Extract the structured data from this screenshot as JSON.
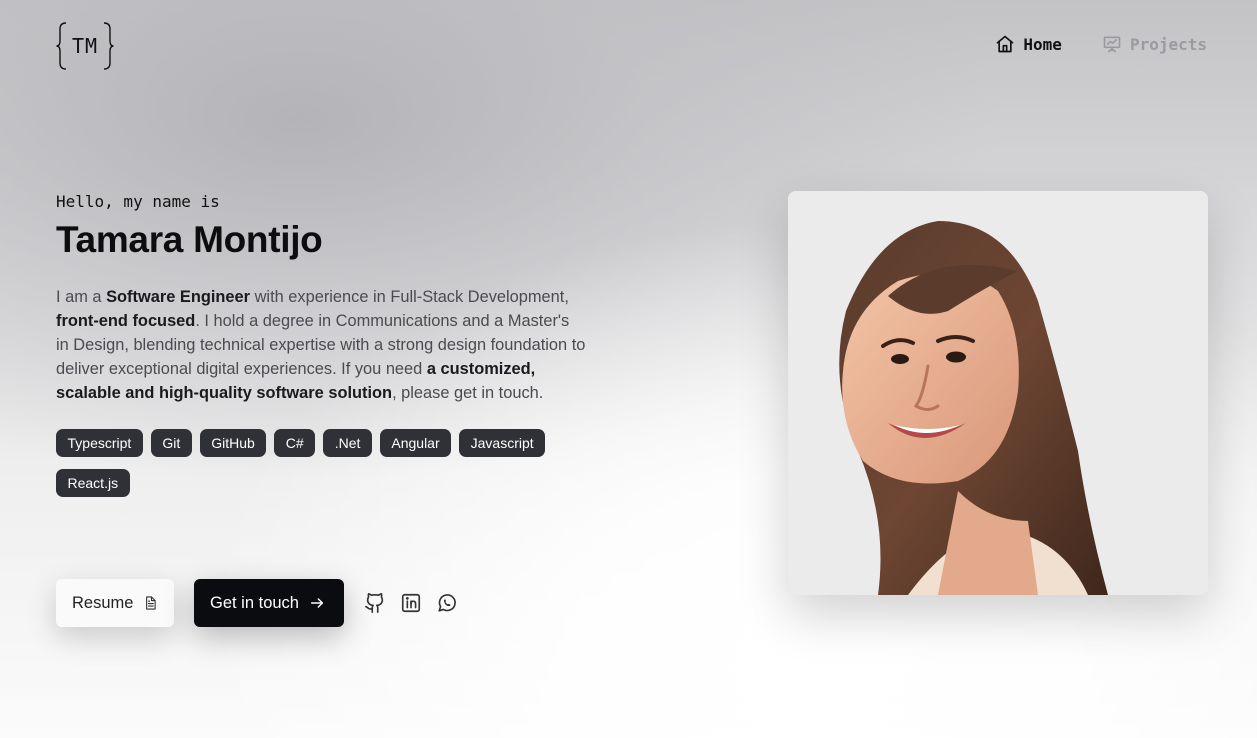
{
  "logo": {
    "text": "TM"
  },
  "nav": {
    "items": [
      {
        "label": "Home",
        "icon": "home-icon",
        "active": true
      },
      {
        "label": "Projects",
        "icon": "presentation-icon",
        "active": false
      }
    ]
  },
  "hero": {
    "greeting": "Hello, my name is",
    "name": "Tamara Montijo",
    "bio": {
      "p1": "I am a ",
      "b1": "Software Engineer",
      "p2": " with experience in Full-Stack Development, ",
      "b2": "front-end focused",
      "p3": ". I hold a degree in Communications and a Master's in Design, blending technical expertise with a strong design foundation to deliver exceptional digital experiences. If you need ",
      "b3": "a customized, scalable and high-quality software solution",
      "p4": ", please get in touch."
    },
    "tags": [
      "Typescript",
      "Git",
      "GitHub",
      "C#",
      ".Net",
      "Angular",
      "Javascript",
      "React.js"
    ]
  },
  "actions": {
    "resume_label": "Resume",
    "contact_label": "Get in touch",
    "socials": [
      "github-icon",
      "linkedin-icon",
      "whatsapp-icon"
    ]
  },
  "colors": {
    "tag_bg": "#2f3137",
    "primary_button_bg": "#0b0c10",
    "nav_inactive": "#9a9aa0"
  }
}
